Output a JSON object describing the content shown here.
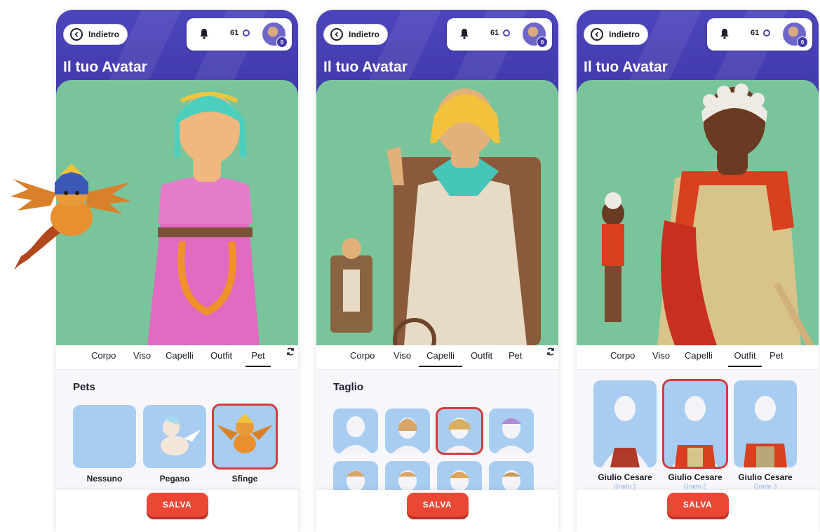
{
  "colors": {
    "header": "#4a44b8",
    "stage": "#7ac49b",
    "accent_red": "#ea4735",
    "card_blue": "#a9cdf1",
    "selected_outline": "#d23d3d"
  },
  "screens": [
    {
      "back_label": "Indietro",
      "coins": "61",
      "avatar_badge": "0",
      "title": "Il tuo Avatar",
      "tabs": [
        "Corpo",
        "Viso",
        "Capelli",
        "Outfit",
        "Pet"
      ],
      "active_tab": "Pet",
      "section_title": "Pets",
      "items": [
        {
          "label": "Nessuno",
          "selected": false
        },
        {
          "label": "Pegaso",
          "selected": false
        },
        {
          "label": "Sfinge",
          "selected": true
        }
      ],
      "save_label": "SALVA"
    },
    {
      "back_label": "Indietro",
      "coins": "61",
      "avatar_badge": "0",
      "title": "Il tuo Avatar",
      "tabs": [
        "Corpo",
        "Viso",
        "Capelli",
        "Outfit",
        "Pet"
      ],
      "active_tab": "Capelli",
      "section_title": "Taglio",
      "hair_options": 8,
      "hair_selected_index": 2,
      "save_label": "SALVA"
    },
    {
      "back_label": "Indietro",
      "coins": "61",
      "avatar_badge": "0",
      "title": "Il tuo Avatar",
      "tabs": [
        "Corpo",
        "Viso",
        "Capelli",
        "Outfit",
        "Pet"
      ],
      "active_tab": "Outfit",
      "items": [
        {
          "label": "Giulio Cesare",
          "grade": "Grado 1",
          "selected": false
        },
        {
          "label": "Giulio Cesare",
          "grade": "Grado 2",
          "selected": true
        },
        {
          "label": "Giulio Cesare",
          "grade": "Grado 3",
          "selected": false
        }
      ],
      "save_label": "SALVA"
    }
  ]
}
